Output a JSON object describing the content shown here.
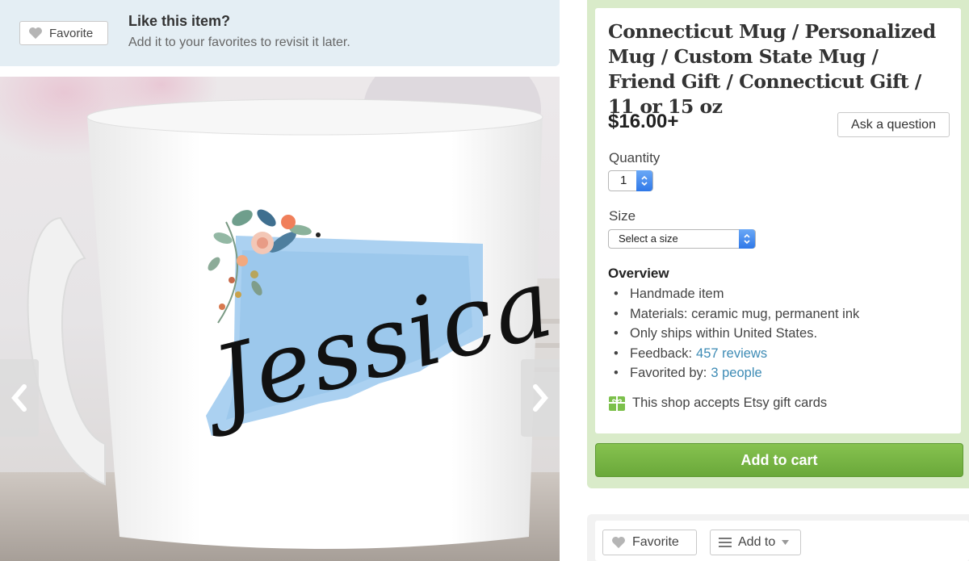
{
  "favorite_banner": {
    "button_label": "Favorite",
    "title": "Like this item?",
    "subtitle": "Add it to your favorites to revisit it later."
  },
  "product_image": {
    "mug_text": "Jessica",
    "prev_icon": "chevron-left-icon",
    "next_icon": "chevron-right-icon"
  },
  "listing": {
    "title": "Connecticut Mug / Personalized Mug / Custom State Mug / Friend Gift / Connecticut Gift / 11 or 15 oz",
    "price": "$16.00+",
    "ask_button": "Ask a question",
    "quantity_label": "Quantity",
    "quantity_value": "1",
    "size_label": "Size",
    "size_value": "Select a size",
    "overview_title": "Overview",
    "overview_items": {
      "handmade": "Handmade item",
      "materials": "Materials: ceramic mug, permanent ink",
      "ships": "Only ships within United States.",
      "feedback_label": "Feedback:",
      "feedback_link": "457 reviews",
      "favorited_label": "Favorited by:",
      "favorited_link": "3 people"
    },
    "gift_card_text": "This shop accepts Etsy gift cards",
    "add_to_cart": "Add to cart"
  },
  "bottom_actions": {
    "favorite_label": "Favorite",
    "add_to_label": "Add to"
  },
  "colors": {
    "banner_bg": "#e4eef4",
    "buy_box_bg": "#d9ebc9",
    "cart_green": "#74b143",
    "link_blue": "#3d8bb5",
    "watercolor_blue": "#9cc9ee"
  }
}
